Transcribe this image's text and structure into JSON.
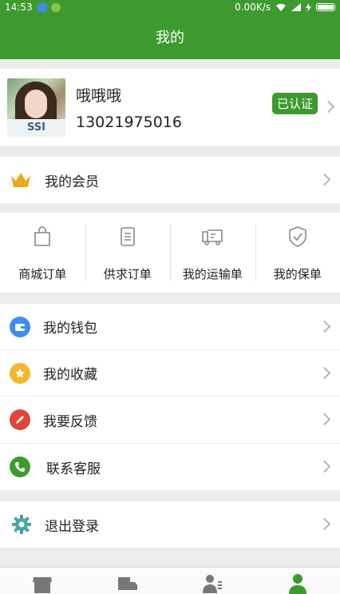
{
  "status_bar": {
    "time": "14:53",
    "network_speed": "0.00K/s"
  },
  "header": {
    "title": "我的"
  },
  "profile": {
    "name": "哦哦哦",
    "phone": "13021975016",
    "badge": "已认证",
    "shirt_text": "SSI"
  },
  "membership": {
    "label": "我的会员",
    "icon": "crown-icon"
  },
  "orders": [
    {
      "label": "商城订单",
      "icon": "shopping-bag-icon"
    },
    {
      "label": "供求订单",
      "icon": "clipboard-icon"
    },
    {
      "label": "我的运输单",
      "icon": "truck-icon"
    },
    {
      "label": "我的保单",
      "icon": "shield-icon"
    }
  ],
  "menu": [
    {
      "label": "我的钱包",
      "icon": "wallet-icon",
      "color": "#3d8ef0"
    },
    {
      "label": "我的收藏",
      "icon": "star-icon",
      "color": "#f3b72b"
    },
    {
      "label": "我要反馈",
      "icon": "pencil-icon",
      "color": "#e0453c"
    },
    {
      "label": "联系客服",
      "icon": "phone-icon",
      "color": "#3d9a2e"
    }
  ],
  "logout": {
    "label": "退出登录",
    "icon": "gear-icon",
    "color": "#4aa6a0"
  },
  "tabbar": [
    {
      "icon": "store-icon",
      "active": false
    },
    {
      "icon": "truck-icon",
      "active": false
    },
    {
      "icon": "contacts-icon",
      "active": false
    },
    {
      "icon": "person-icon",
      "active": true
    }
  ],
  "theme": {
    "primary": "#3d9a2e",
    "background": "#ececec"
  }
}
